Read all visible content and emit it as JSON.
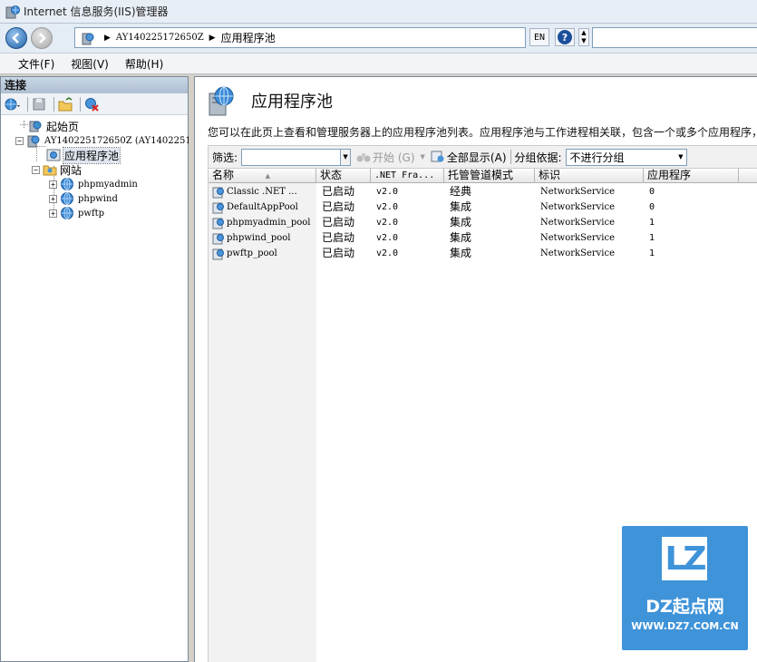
{
  "window": {
    "title": "Internet 信息服务(IIS)管理器"
  },
  "address": {
    "crumbs": [
      "AY140225172650Z",
      "应用程序池"
    ],
    "lang": "EN",
    "help_label": "?"
  },
  "menu": {
    "items": [
      "文件(F)",
      "视图(V)",
      "帮助(H)"
    ]
  },
  "connections": {
    "header": "连接",
    "tree": {
      "start_page": "起始页",
      "server": "AY140225172650Z (AY1402251",
      "app_pools": "应用程序池",
      "sites": "网站",
      "site_items": [
        "phpmyadmin",
        "phpwind",
        "pwftp"
      ]
    }
  },
  "main": {
    "title": "应用程序池",
    "description": "您可以在此页上查看和管理服务器上的应用程序池列表。应用程序池与工作进程相关联，包含一个或多个应用程序，",
    "filter": {
      "label": "筛选:",
      "start": "开始 (G)",
      "show_all": "全部显示(A)",
      "group_by_label": "分组依据:",
      "group_by_value": "不进行分组"
    },
    "columns": [
      "名称",
      "状态",
      ".NET Fra...",
      "托管管道模式",
      "标识",
      "应用程序"
    ],
    "rows": [
      [
        "Classic .NET ...",
        "已启动",
        "v2.0",
        "经典",
        "NetworkService",
        "0"
      ],
      [
        "DefaultAppPool",
        "已启动",
        "v2.0",
        "集成",
        "NetworkService",
        "0"
      ],
      [
        "phpmyadmin_pool",
        "已启动",
        "v2.0",
        "集成",
        "NetworkService",
        "1"
      ],
      [
        "phpwind_pool",
        "已启动",
        "v2.0",
        "集成",
        "NetworkService",
        "1"
      ],
      [
        "pwftp_pool",
        "已启动",
        "v2.0",
        "集成",
        "NetworkService",
        "1"
      ]
    ]
  },
  "watermark": {
    "logo": "LZ",
    "text": "DZ起点网",
    "url": "WWW.DZ7.COM.CN"
  }
}
